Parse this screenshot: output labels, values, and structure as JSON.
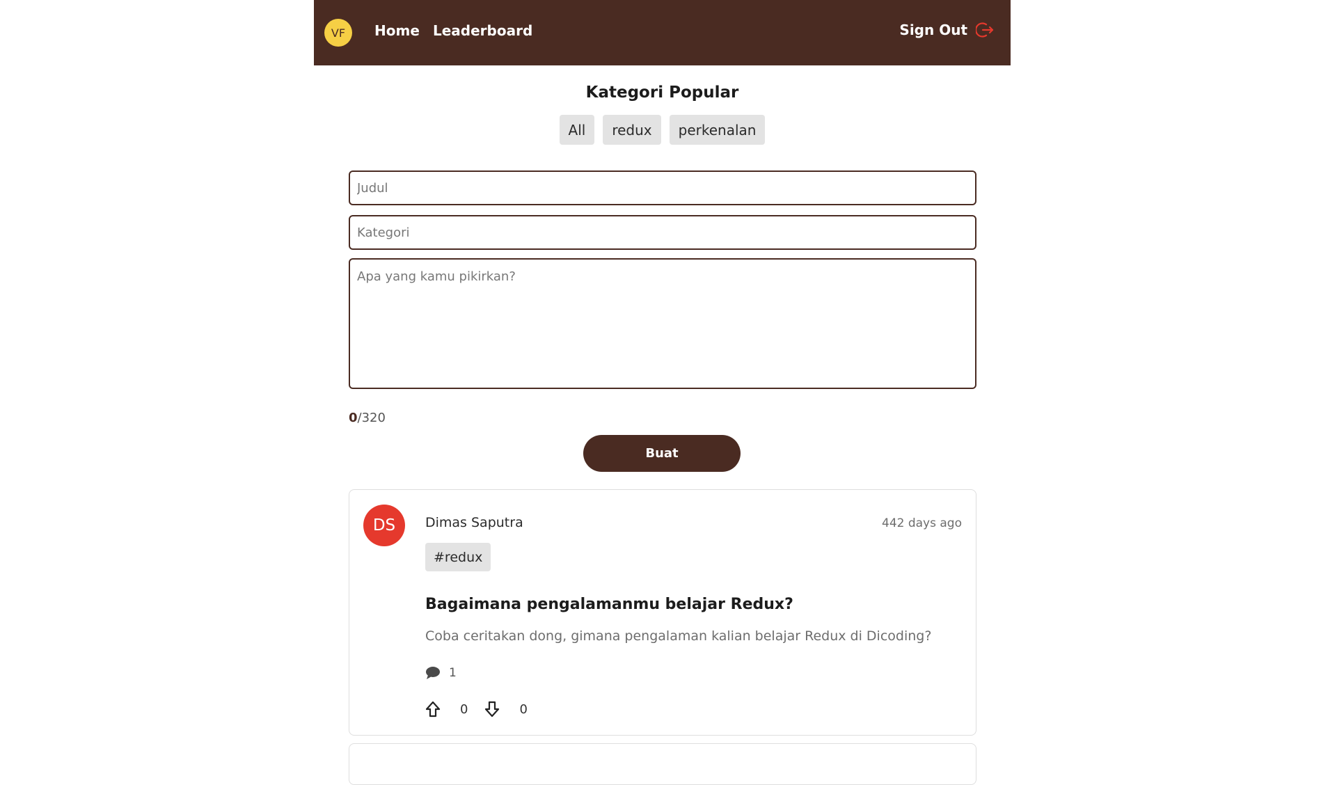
{
  "header": {
    "avatar_initials": "VF",
    "nav": [
      {
        "label": "Home"
      },
      {
        "label": "Leaderboard"
      }
    ],
    "signout_label": "Sign Out",
    "signout_icon": "logout-icon",
    "colors": {
      "bar": "#4a2b22",
      "avatar": "#f6cf45",
      "signout_icon": "#e5392d"
    }
  },
  "categories": {
    "title": "Kategori Popular",
    "items": [
      {
        "label": "All"
      },
      {
        "label": "redux"
      },
      {
        "label": "perkenalan"
      }
    ]
  },
  "form": {
    "title_placeholder": "Judul",
    "category_placeholder": "Kategori",
    "body_placeholder": "Apa yang kamu pikirkan?",
    "counter_current": "0",
    "counter_max": "/320",
    "submit_label": "Buat"
  },
  "threads": [
    {
      "avatar_initials": "DS",
      "owner": "Dimas Saputra",
      "created": "442 days ago",
      "tag": "#redux",
      "title": "Bagaimana pengalamanmu belajar Redux?",
      "body": "Coba ceritakan dong, gimana pengalaman kalian belajar Redux di Dicoding?",
      "comments": "1",
      "upvotes": "0",
      "downvotes": "0",
      "avatar_color": "#e5392d"
    }
  ]
}
